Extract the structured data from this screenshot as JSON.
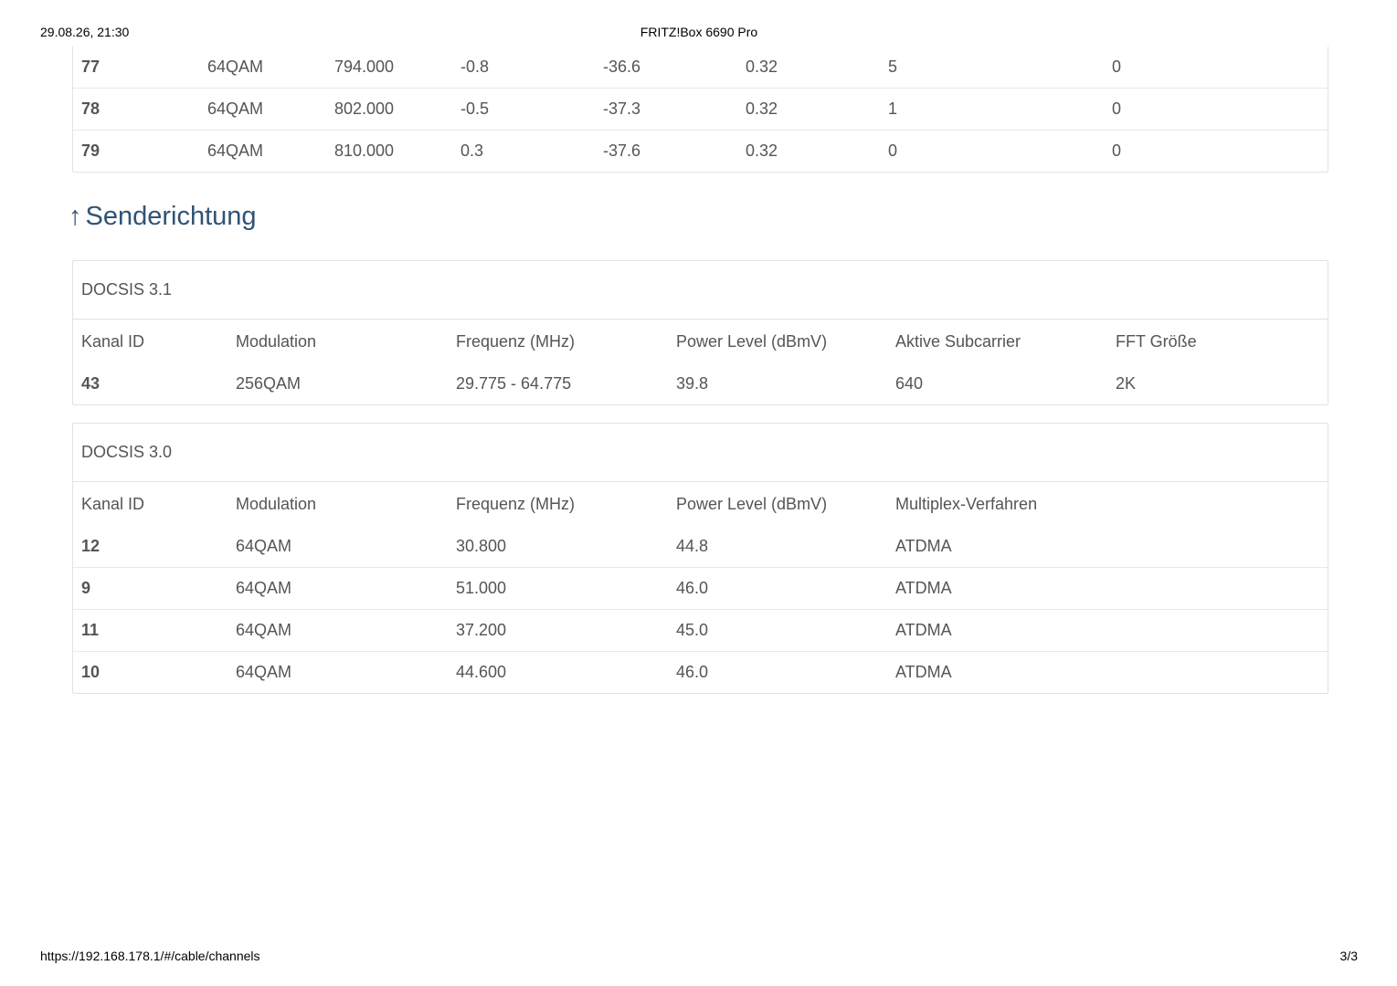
{
  "print_header": {
    "datetime": "29.08.26, 21:30",
    "title": "FRITZ!Box 6690 Pro"
  },
  "downstream_tail": {
    "rows": [
      {
        "id": "77",
        "modulation": "64QAM",
        "frequency": "794.000",
        "power": "-0.8",
        "mse": "-36.6",
        "latency": "0.32",
        "corrected": "5",
        "uncorrectable": "0"
      },
      {
        "id": "78",
        "modulation": "64QAM",
        "frequency": "802.000",
        "power": "-0.5",
        "mse": "-37.3",
        "latency": "0.32",
        "corrected": "1",
        "uncorrectable": "0"
      },
      {
        "id": "79",
        "modulation": "64QAM",
        "frequency": "810.000",
        "power": "0.3",
        "mse": "-37.6",
        "latency": "0.32",
        "corrected": "0",
        "uncorrectable": "0"
      }
    ]
  },
  "upstream": {
    "arrow_icon": "arrow-up-icon",
    "arrow": "↑",
    "heading": "Senderichtung",
    "docsis31": {
      "title": "DOCSIS 3.1",
      "headers": [
        "Kanal ID",
        "Modulation",
        "Frequenz (MHz)",
        "Power Level (dBmV)",
        "Aktive Subcarrier",
        "FFT Größe"
      ],
      "rows": [
        {
          "id": "43",
          "modulation": "256QAM",
          "frequency": "29.775 - 64.775",
          "power": "39.8",
          "subcarrier": "640",
          "fft": "2K"
        }
      ]
    },
    "docsis30": {
      "title": "DOCSIS 3.0",
      "headers": [
        "Kanal ID",
        "Modulation",
        "Frequenz (MHz)",
        "Power Level (dBmV)",
        "Multiplex-Verfahren"
      ],
      "rows": [
        {
          "id": "12",
          "modulation": "64QAM",
          "frequency": "30.800",
          "power": "44.8",
          "multiplex": "ATDMA"
        },
        {
          "id": "9",
          "modulation": "64QAM",
          "frequency": "51.000",
          "power": "46.0",
          "multiplex": "ATDMA"
        },
        {
          "id": "11",
          "modulation": "64QAM",
          "frequency": "37.200",
          "power": "45.0",
          "multiplex": "ATDMA"
        },
        {
          "id": "10",
          "modulation": "64QAM",
          "frequency": "44.600",
          "power": "46.0",
          "multiplex": "ATDMA"
        }
      ]
    }
  },
  "print_footer": {
    "url": "https://192.168.178.1/#/cable/channels",
    "page": "3/3"
  },
  "colors": {
    "heading": "#2f5375",
    "text": "#555555",
    "border": "#dfe3e6"
  }
}
